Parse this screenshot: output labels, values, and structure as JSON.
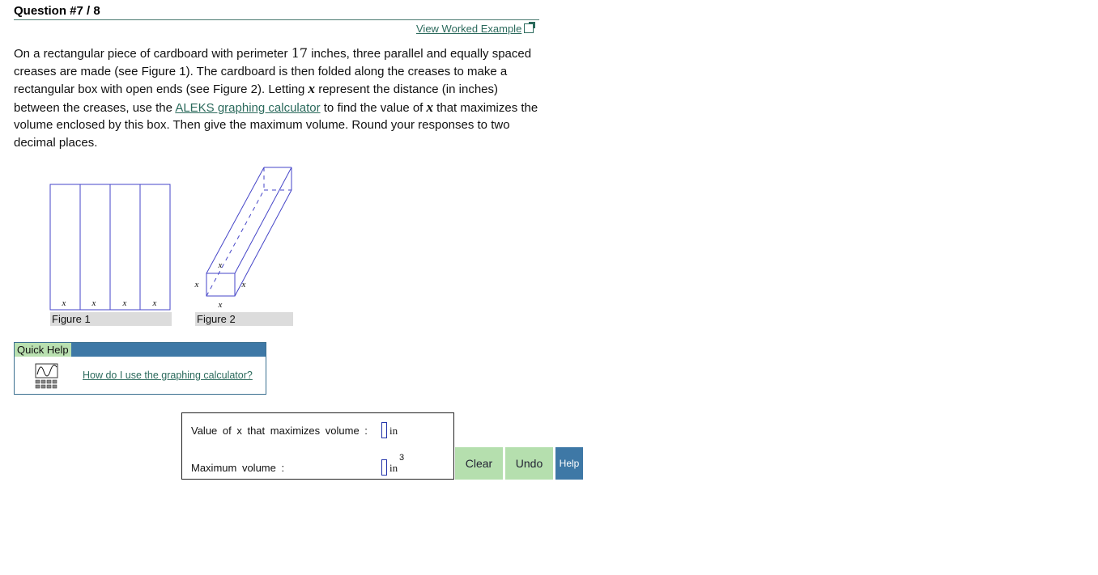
{
  "header": {
    "title": "Question #7 / 8"
  },
  "worked_example": {
    "label": "View Worked Example"
  },
  "problem": {
    "text_1": "On a rectangular piece of cardboard with perimeter ",
    "perimeter": "17",
    "text_2": " inches, three parallel and equally spaced creases are made (see Figure 1). The cardboard is then folded along the creases to make a rectangular box with open ends (see Figure 2). Letting ",
    "var_1": "x",
    "text_3": " represent the distance (in inches) between the creases, use the ",
    "calc_link": "ALEKS graphing calculator",
    "text_4": " to find the value of ",
    "var_2": "x",
    "text_5": " that maximizes the volume enclosed by this box. Then give the maximum volume. Round your responses to two decimal places."
  },
  "figures": {
    "fig1_label": "Figure 1",
    "fig2_label": "Figure 2",
    "var": "x"
  },
  "quick_help": {
    "title": "Quick Help",
    "link": "How do I use the graphing calculator?"
  },
  "answers": {
    "value_label": "Value of x that maximizes volume :",
    "value_unit": "in",
    "max_label": "Maximum volume :",
    "max_unit": "in",
    "max_exp": "3"
  },
  "buttons": {
    "clear": "Clear",
    "undo": "Undo",
    "help": "Help"
  },
  "colors": {
    "accent_blue": "#3e78a6",
    "button_green": "#b5dfae",
    "link_green": "#2b6a5c",
    "figure_line": "#4646c8"
  }
}
